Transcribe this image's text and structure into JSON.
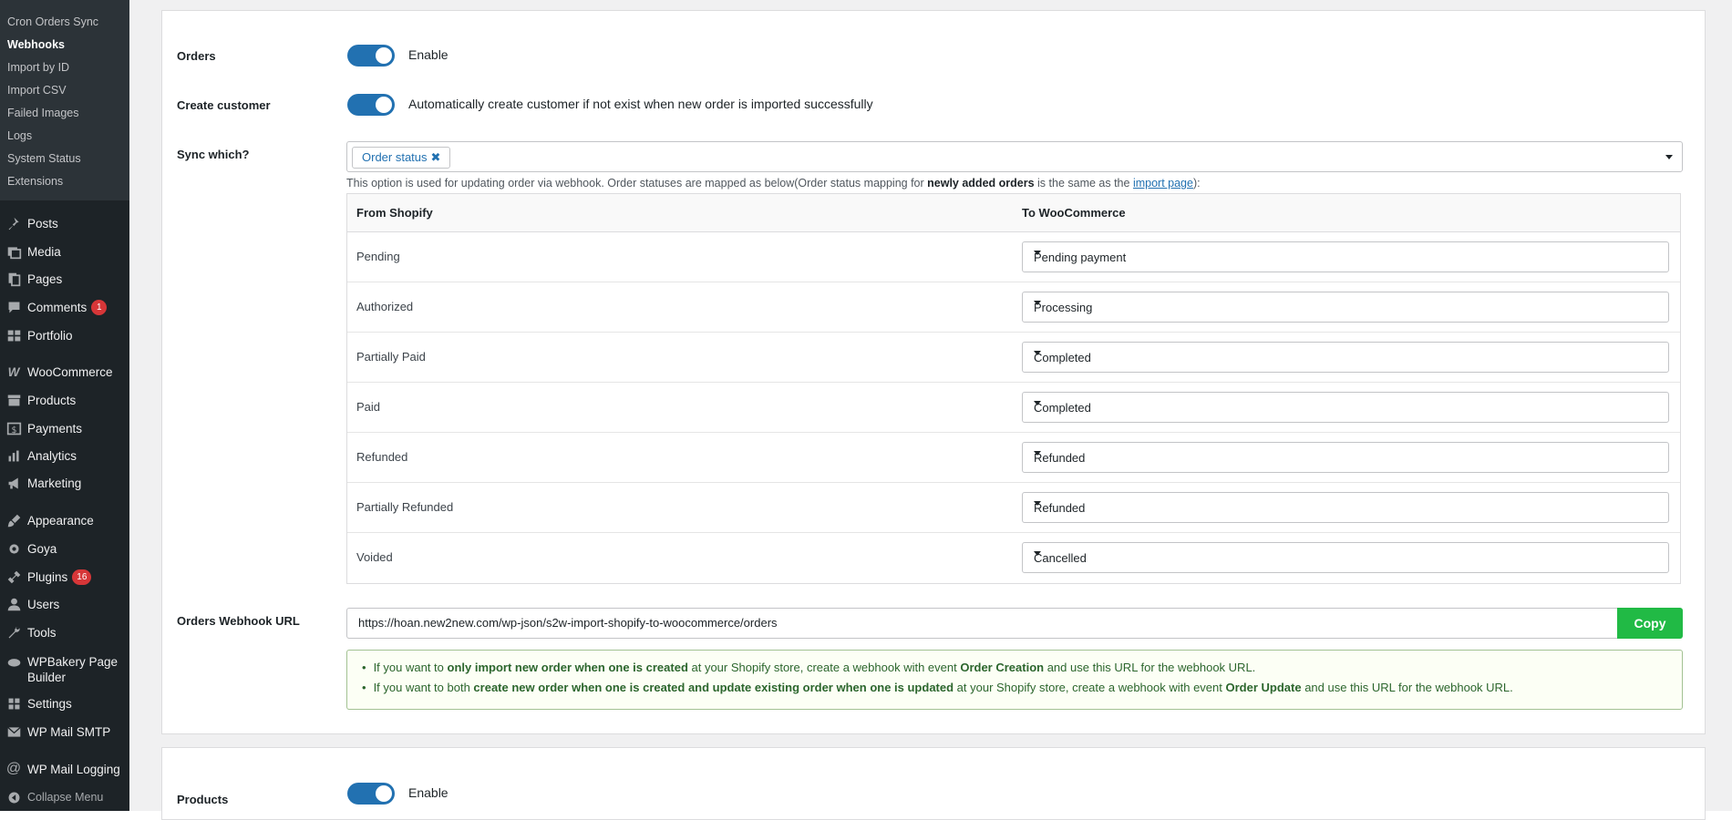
{
  "sidebar": {
    "submenu": [
      {
        "label": "Cron Orders Sync",
        "current": false
      },
      {
        "label": "Webhooks",
        "current": true
      },
      {
        "label": "Import by ID",
        "current": false
      },
      {
        "label": "Import CSV",
        "current": false
      },
      {
        "label": "Failed Images",
        "current": false
      },
      {
        "label": "Logs",
        "current": false
      },
      {
        "label": "System Status",
        "current": false
      },
      {
        "label": "Extensions",
        "current": false
      }
    ],
    "menu": [
      {
        "label": "Posts",
        "icon": "pin-icon"
      },
      {
        "label": "Media",
        "icon": "media-icon"
      },
      {
        "label": "Pages",
        "icon": "pages-icon"
      },
      {
        "label": "Comments",
        "icon": "comment-icon",
        "badge": "1"
      },
      {
        "label": "Portfolio",
        "icon": "portfolio-icon"
      },
      {
        "label": "WooCommerce",
        "icon": "woo-icon"
      },
      {
        "label": "Products",
        "icon": "archive-icon"
      },
      {
        "label": "Payments",
        "icon": "dollar-icon"
      },
      {
        "label": "Analytics",
        "icon": "chart-icon"
      },
      {
        "label": "Marketing",
        "icon": "megaphone-icon"
      },
      {
        "label": "Appearance",
        "icon": "brush-icon"
      },
      {
        "label": "Goya",
        "icon": "gear-icon"
      },
      {
        "label": "Plugins",
        "icon": "plugin-icon",
        "badge": "16"
      },
      {
        "label": "Users",
        "icon": "user-icon"
      },
      {
        "label": "Tools",
        "icon": "wrench-icon"
      },
      {
        "label": "WPBakery Page Builder",
        "icon": "cloud-icon"
      },
      {
        "label": "Settings",
        "icon": "settings-icon"
      },
      {
        "label": "WP Mail SMTP",
        "icon": "mail-icon"
      },
      {
        "label": "WP Mail Logging",
        "icon": "at-icon"
      },
      {
        "label": "Collapse Menu",
        "icon": "collapse-icon"
      }
    ]
  },
  "orders": {
    "label": "Orders",
    "toggle_text": "Enable",
    "enabled": true
  },
  "create_customer": {
    "label": "Create customer",
    "toggle_text": "Automatically create customer if not exist when new order is imported successfully",
    "enabled": true
  },
  "sync_which": {
    "label": "Sync which?",
    "tag": "Order status",
    "desc_pre": "This option is used for updating order via webhook. Order statuses are mapped as below(Order status mapping for ",
    "desc_bold": "newly added orders",
    "desc_mid": " is the same as the ",
    "desc_link": "import page",
    "desc_post": "):"
  },
  "mapping": {
    "col_from": "From Shopify",
    "col_to": "To WooCommerce",
    "rows": [
      {
        "from": "Pending",
        "to": "Pending payment"
      },
      {
        "from": "Authorized",
        "to": "Processing"
      },
      {
        "from": "Partially Paid",
        "to": "Completed"
      },
      {
        "from": "Paid",
        "to": "Completed"
      },
      {
        "from": "Refunded",
        "to": "Refunded"
      },
      {
        "from": "Partially Refunded",
        "to": "Refunded"
      },
      {
        "from": "Voided",
        "to": "Cancelled"
      }
    ]
  },
  "webhook": {
    "label": "Orders Webhook URL",
    "url": "https://hoan.new2new.com/wp-json/s2w-import-shopify-to-woocommerce/orders",
    "copy_label": "Copy",
    "note1_pre": "If you want to ",
    "note1_bold": "only import new order when one is created",
    "note1_mid": " at your Shopify store, create a webhook with event ",
    "note1_event": "Order Creation",
    "note1_post": " and use this URL for the webhook URL.",
    "note2_pre": "If you want to both ",
    "note2_bold": "create new order when one is created and update existing order when one is updated",
    "note2_mid": " at your Shopify store, create a webhook with event ",
    "note2_event": "Order Update",
    "note2_post": " and use this URL for the webhook URL."
  },
  "products": {
    "label": "Products",
    "toggle_text": "Enable",
    "enabled": true
  },
  "colors": {
    "sidebar_bg": "#1d2327",
    "submenu_bg": "#2c3338",
    "toggle_on": "#2271b1",
    "copy_button": "#21ba45",
    "badge": "#d63638"
  }
}
